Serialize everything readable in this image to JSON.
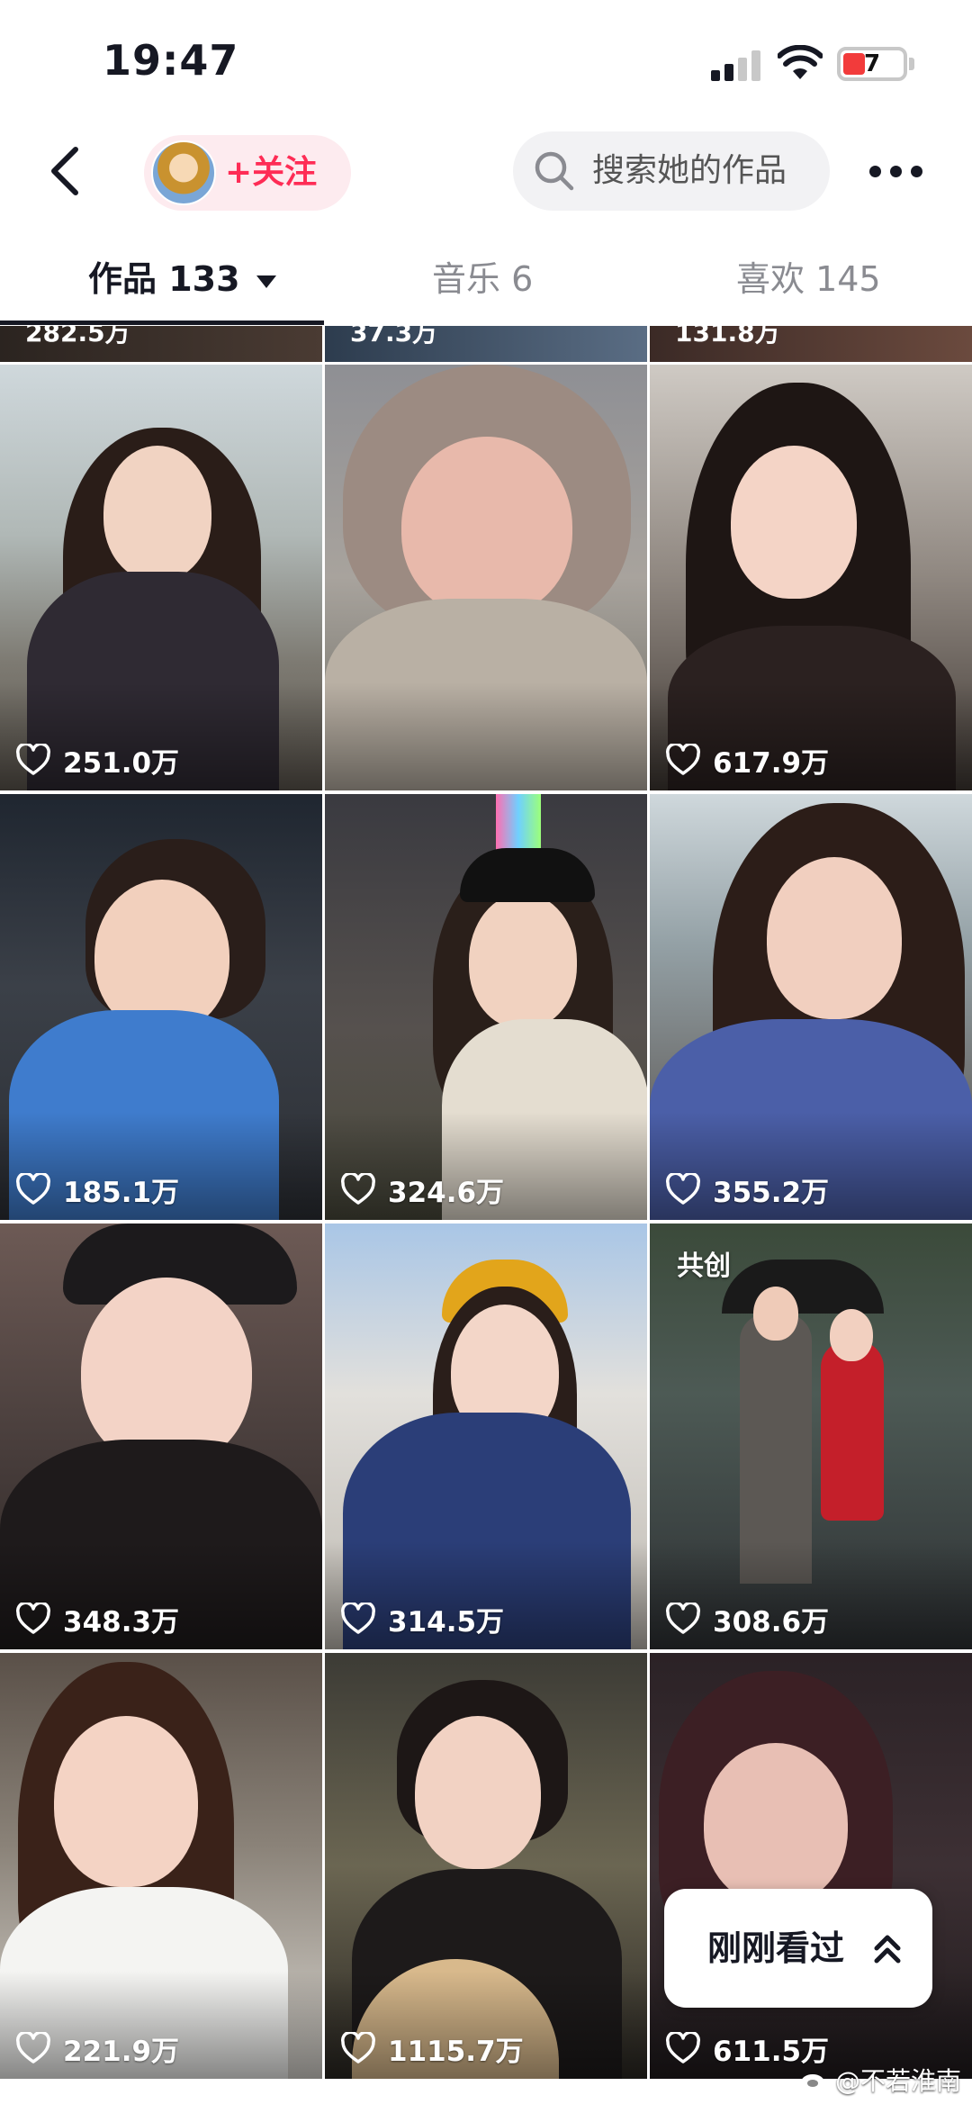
{
  "status_bar": {
    "time": "19:47",
    "battery": "7"
  },
  "header": {
    "follow_label": "+关注",
    "search_placeholder": "搜索她的作品"
  },
  "tabs": [
    {
      "label": "作品 133",
      "active": true
    },
    {
      "label": "音乐 6",
      "active": false
    },
    {
      "label": "喜欢 145",
      "active": false
    }
  ],
  "grid": {
    "peek_row": [
      "282.5万",
      "37.3万",
      "131.8万"
    ],
    "cells": [
      {
        "likes": "251.0万"
      },
      {
        "likes": "617.9万"
      },
      {
        "likes": "185.1万"
      },
      {
        "likes": "324.6万"
      },
      {
        "likes": "355.2万"
      },
      {
        "likes": "348.3万"
      },
      {
        "likes": "314.5万"
      },
      {
        "likes": "308.6万",
        "badge": "共创"
      },
      {
        "likes": "221.9万"
      },
      {
        "likes": "1115.7万"
      },
      {
        "likes": "611.5万"
      }
    ]
  },
  "recently_viewed": {
    "label": "刚刚看过"
  },
  "watermark": "@不若淮南",
  "colors": {
    "accent": "#fe2c55",
    "follow_bg": "#fdebef",
    "search_bg": "#f2f2f4"
  },
  "icons": [
    "back-icon",
    "avatar",
    "search-icon",
    "more-icon",
    "heart-icon",
    "chevron-up-icon",
    "weibo-icon"
  ]
}
